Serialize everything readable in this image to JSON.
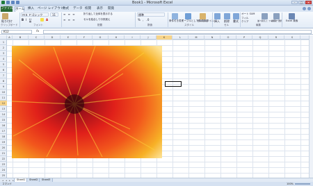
{
  "window": {
    "title": "Book1 - Microsoft Excel"
  },
  "tabs": [
    "ファイル",
    "ホーム",
    "挿入",
    "ページ レイアウト",
    "数式",
    "データ",
    "校閲",
    "表示",
    "開発"
  ],
  "ribbon": {
    "font_name": "ＭＳ Ｐゴシック",
    "font_size": "11",
    "number_format": "標準",
    "group_labels": [
      "クリップボード",
      "フォント",
      "配置",
      "数値",
      "スタイル",
      "セル",
      "編集"
    ],
    "paste_label": "貼り付け",
    "wrap_label": "折り返して全体を表示する",
    "merge_label": "セルを結合して中央揃え",
    "conditional_label": "条件付き書式",
    "table_label": "テーブルとして書式設定",
    "cellstyle_label": "セルのスタイル",
    "insert_label": "挿入",
    "delete_label": "削除",
    "format_label": "書式",
    "autosum_label": "オート SUM",
    "fill_label": "フィル",
    "clear_label": "クリア",
    "sort_label": "並べ替えと フィルター",
    "find_label": "検索と 選択",
    "search_label": "Excel 検索"
  },
  "formula_bar": {
    "name_box": "K12",
    "fx": "fx",
    "value": ""
  },
  "grid": {
    "columns": [
      "A",
      "B",
      "C",
      "D",
      "E",
      "F",
      "G",
      "H",
      "I",
      "J",
      "K",
      "L",
      "M",
      "N",
      "O",
      "P",
      "Q",
      "R",
      "S"
    ],
    "rows": [
      "1",
      "2",
      "3",
      "4",
      "5",
      "6",
      "7",
      "8",
      "9",
      "10",
      "11",
      "12",
      "13",
      "14",
      "15",
      "16",
      "17",
      "18",
      "19",
      "20",
      "21",
      "22",
      "23",
      "24",
      "25"
    ],
    "active_column": "K",
    "active_row": "12"
  },
  "sheets": [
    "Sheet1",
    "Sheet2",
    "Sheet3"
  ],
  "active_sheet": "Sheet1",
  "status": {
    "ready": "コマンド",
    "zoom": "100%"
  },
  "colors": {
    "file_tab": "#2b6a36",
    "active_header": "#f7d48a",
    "ribbon_bg": "#e3ecf7"
  }
}
